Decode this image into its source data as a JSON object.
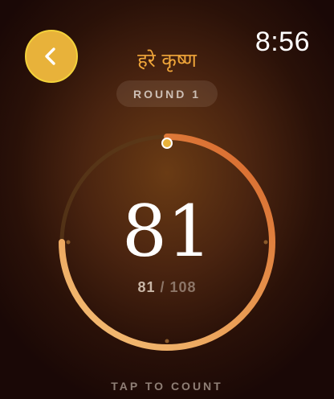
{
  "header": {
    "back_icon": "chevron-left-icon",
    "clock": "8:56",
    "title": "हरे कृष्ण"
  },
  "round": {
    "label": "ROUND 1"
  },
  "counter": {
    "count": "81",
    "current": "81",
    "separator": "/",
    "total": "108",
    "progress_fraction": 0.75
  },
  "footer": {
    "hint": "TAP TO COUNT"
  },
  "colors": {
    "accent": "#e8b23a",
    "title": "#f0a63a",
    "ring_start": "#d86a2e",
    "ring_end": "#f0b66a",
    "track": "#5a3a1a"
  }
}
